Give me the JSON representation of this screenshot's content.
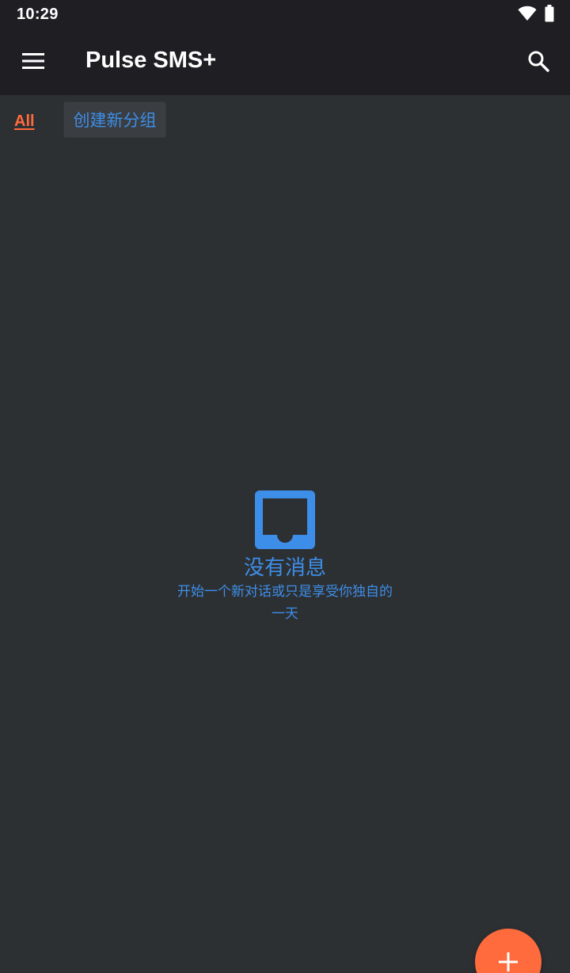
{
  "status_bar": {
    "time": "10:29",
    "icons": [
      "wifi-icon",
      "battery-icon"
    ]
  },
  "app_bar": {
    "title": "Pulse SMS+",
    "menu_icon": "menu-icon",
    "search_icon": "search-icon"
  },
  "tabs": {
    "all_label": "All",
    "create_group_label": "创建新分组"
  },
  "empty_state": {
    "icon": "inbox-icon",
    "title": "没有消息",
    "subtitle": "开始一个新对话或只是享受你独自的一天"
  },
  "fab": {
    "icon": "plus-icon"
  },
  "colors": {
    "background": "#2d3033",
    "bar": "#1f1f23",
    "accent": "#ff6b3d",
    "primary": "#3d8ee8"
  }
}
